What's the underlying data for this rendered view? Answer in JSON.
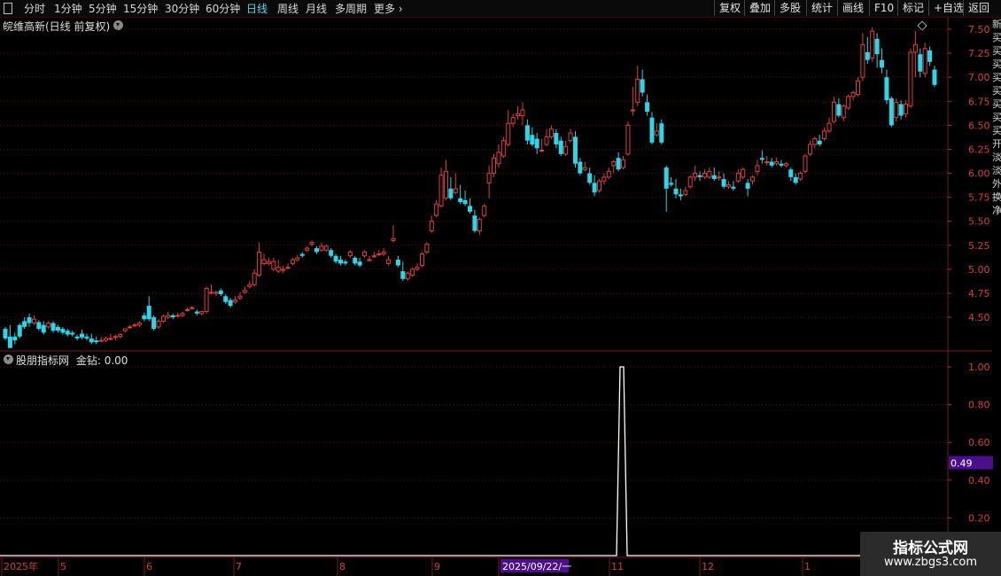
{
  "toolbar": {
    "periods": [
      "分时",
      "1分钟",
      "5分钟",
      "15分钟",
      "30分钟",
      "60分钟",
      "日线",
      "周线",
      "月线",
      "多周期",
      "更多"
    ],
    "active": "日线",
    "right_buttons": [
      "复权",
      "叠加",
      "多股",
      "统计",
      "画线",
      "F10",
      "标记",
      "+自选",
      "返回"
    ]
  },
  "main": {
    "title": "皖维高新(日线 前复权)"
  },
  "indicator": {
    "title": "股朋指标网",
    "value_label": "金钻: 0.00",
    "current_value_box": "0.49"
  },
  "watermark": {
    "line1": "指标公式网",
    "line2": "www.zbgs3.com"
  },
  "right_strip": [
    "新",
    "买",
    "买",
    "买",
    "买",
    "买",
    "买",
    "买",
    "买",
    "开",
    "淡",
    "淡",
    "外",
    "换",
    "净"
  ],
  "colors": {
    "up": "#e0403c",
    "down": "#2ed5e6",
    "grid": "#5a1212",
    "axis_text": "#d04040",
    "bg": "#000000",
    "highlight": "#4b0f8a"
  },
  "chart_data": [
    {
      "type": "candlestick",
      "ylim": [
        4.15,
        7.62
      ],
      "y_ticks": [
        "7.50",
        "7.25",
        "7.00",
        "6.75",
        "6.50",
        "6.25",
        "6.00",
        "5.75",
        "5.50",
        "5.25",
        "5.00",
        "4.75",
        "4.50"
      ],
      "x_ticks": [
        "2025年",
        "5",
        "6",
        "7",
        "8",
        "9",
        "2025/09/22/一",
        "11",
        "12",
        "1"
      ],
      "candles": [
        [
          4.38,
          4.4,
          4.28,
          4.26
        ],
        [
          4.3,
          4.42,
          4.18,
          4.2
        ],
        [
          4.3,
          4.34,
          4.26,
          4.22
        ],
        [
          4.42,
          4.44,
          4.3,
          4.28
        ],
        [
          4.46,
          4.5,
          4.4,
          4.38
        ],
        [
          4.5,
          4.54,
          4.44,
          4.4
        ],
        [
          4.44,
          4.52,
          4.48,
          4.42
        ],
        [
          4.45,
          4.47,
          4.38,
          4.36
        ],
        [
          4.42,
          4.46,
          4.34,
          4.32
        ],
        [
          4.4,
          4.46,
          4.44,
          4.38
        ],
        [
          4.44,
          4.46,
          4.36,
          4.34
        ],
        [
          4.4,
          4.42,
          4.36,
          4.34
        ],
        [
          4.38,
          4.4,
          4.34,
          4.32
        ],
        [
          4.36,
          4.38,
          4.32,
          4.3
        ],
        [
          4.34,
          4.36,
          4.32,
          4.3
        ],
        [
          4.3,
          4.32,
          4.28,
          4.26
        ],
        [
          4.33,
          4.37,
          4.29,
          4.27
        ],
        [
          4.3,
          4.33,
          4.28,
          4.26
        ],
        [
          4.28,
          4.33,
          4.24,
          4.22
        ],
        [
          4.26,
          4.3,
          4.24,
          4.22
        ],
        [
          4.26,
          4.3,
          4.26,
          4.24
        ],
        [
          4.26,
          4.3,
          4.28,
          4.24
        ],
        [
          4.28,
          4.33,
          4.28,
          4.26
        ],
        [
          4.29,
          4.32,
          4.3,
          4.26
        ],
        [
          4.3,
          4.34,
          4.32,
          4.28
        ],
        [
          4.36,
          4.38,
          4.38,
          4.34
        ],
        [
          4.4,
          4.42,
          4.4,
          4.38
        ],
        [
          4.42,
          4.44,
          4.42,
          4.4
        ],
        [
          4.42,
          4.46,
          4.44,
          4.4
        ],
        [
          4.52,
          4.55,
          4.48,
          4.46
        ],
        [
          4.62,
          4.72,
          4.48,
          4.46
        ],
        [
          4.5,
          4.52,
          4.38,
          4.36
        ],
        [
          4.4,
          4.48,
          4.46,
          4.38
        ],
        [
          4.46,
          4.53,
          4.51,
          4.44
        ],
        [
          4.5,
          4.56,
          4.52,
          4.48
        ],
        [
          4.52,
          4.54,
          4.5,
          4.48
        ],
        [
          4.52,
          4.55,
          4.52,
          4.5
        ],
        [
          4.52,
          4.56,
          4.54,
          4.5
        ],
        [
          4.58,
          4.6,
          4.58,
          4.56
        ],
        [
          4.6,
          4.62,
          4.6,
          4.58
        ],
        [
          4.56,
          4.58,
          4.54,
          4.52
        ],
        [
          4.54,
          4.56,
          4.56,
          4.52
        ],
        [
          4.56,
          4.82,
          4.8,
          4.54
        ],
        [
          4.76,
          4.84,
          4.76,
          4.74
        ],
        [
          4.75,
          4.78,
          4.76,
          4.72
        ],
        [
          4.78,
          4.8,
          4.74,
          4.72
        ],
        [
          4.72,
          4.74,
          4.66,
          4.64
        ],
        [
          4.68,
          4.7,
          4.62,
          4.6
        ],
        [
          4.66,
          4.72,
          4.68,
          4.64
        ],
        [
          4.7,
          4.76,
          4.72,
          4.68
        ],
        [
          4.76,
          4.82,
          4.78,
          4.74
        ],
        [
          4.82,
          4.88,
          4.84,
          4.8
        ],
        [
          4.84,
          5.0,
          4.96,
          4.82
        ],
        [
          4.94,
          5.28,
          5.18,
          4.92
        ],
        [
          5.06,
          5.16,
          5.1,
          5.04
        ],
        [
          5.06,
          5.12,
          5.08,
          5.04
        ],
        [
          5.0,
          5.12,
          5.08,
          4.98
        ],
        [
          4.98,
          5.1,
          5.02,
          4.96
        ],
        [
          4.99,
          5.04,
          5.0,
          4.96
        ],
        [
          5.02,
          5.06,
          5.02,
          5.0
        ],
        [
          5.06,
          5.12,
          5.1,
          5.04
        ],
        [
          5.1,
          5.15,
          5.12,
          5.08
        ],
        [
          5.16,
          5.18,
          5.14,
          5.12
        ],
        [
          5.2,
          5.24,
          5.22,
          5.18
        ],
        [
          5.26,
          5.3,
          5.28,
          5.24
        ],
        [
          5.22,
          5.24,
          5.18,
          5.16
        ],
        [
          5.2,
          5.28,
          5.24,
          5.18
        ],
        [
          5.2,
          5.26,
          5.24,
          5.18
        ],
        [
          5.2,
          5.22,
          5.14,
          5.12
        ],
        [
          5.14,
          5.16,
          5.08,
          5.06
        ],
        [
          5.1,
          5.14,
          5.06,
          5.04
        ],
        [
          5.08,
          5.1,
          5.06,
          5.04
        ],
        [
          5.14,
          5.2,
          5.18,
          5.12
        ],
        [
          5.12,
          5.14,
          5.06,
          5.04
        ],
        [
          5.08,
          5.12,
          5.04,
          5.02
        ],
        [
          5.14,
          5.2,
          5.18,
          5.12
        ],
        [
          5.1,
          5.14,
          5.1,
          5.08
        ],
        [
          5.14,
          5.18,
          5.14,
          5.12
        ],
        [
          5.16,
          5.2,
          5.16,
          5.14
        ],
        [
          5.16,
          5.22,
          5.18,
          5.14
        ],
        [
          5.06,
          5.14,
          5.1,
          5.04
        ],
        [
          5.3,
          5.46,
          5.32,
          5.28
        ],
        [
          5.1,
          5.14,
          5.04,
          5.02
        ],
        [
          4.98,
          5.08,
          4.9,
          4.88
        ],
        [
          4.9,
          4.98,
          4.96,
          4.88
        ],
        [
          4.94,
          5.02,
          5.0,
          4.92
        ],
        [
          5.0,
          5.06,
          5.02,
          4.98
        ],
        [
          5.04,
          5.18,
          5.16,
          5.02
        ],
        [
          5.18,
          5.28,
          5.26,
          5.16
        ],
        [
          5.4,
          5.56,
          5.5,
          5.38
        ],
        [
          5.56,
          5.72,
          5.68,
          5.54
        ],
        [
          5.66,
          6.06,
          5.98,
          5.64
        ],
        [
          5.74,
          6.14,
          6.02,
          5.72
        ],
        [
          5.84,
          5.96,
          5.74,
          5.72
        ],
        [
          5.8,
          6.0,
          5.84,
          5.78
        ],
        [
          5.74,
          5.88,
          5.7,
          5.68
        ],
        [
          5.72,
          5.82,
          5.68,
          5.66
        ],
        [
          5.66,
          5.74,
          5.6,
          5.58
        ],
        [
          5.56,
          5.62,
          5.4,
          5.38
        ],
        [
          5.4,
          5.54,
          5.52,
          5.36
        ],
        [
          5.56,
          5.68,
          5.66,
          5.54
        ],
        [
          5.9,
          6.08,
          6.0,
          5.74
        ],
        [
          6.0,
          6.2,
          6.16,
          5.96
        ],
        [
          6.1,
          6.3,
          6.22,
          6.06
        ],
        [
          6.18,
          6.38,
          6.34,
          6.16
        ],
        [
          6.3,
          6.66,
          6.52,
          6.28
        ],
        [
          6.52,
          6.62,
          6.58,
          6.48
        ],
        [
          6.6,
          6.7,
          6.62,
          6.56
        ],
        [
          6.6,
          6.74,
          6.66,
          6.5
        ],
        [
          6.5,
          6.56,
          6.34,
          6.3
        ],
        [
          6.4,
          6.48,
          6.3,
          6.28
        ],
        [
          6.36,
          6.42,
          6.26,
          6.2
        ],
        [
          6.24,
          6.36,
          6.24,
          6.22
        ],
        [
          6.3,
          6.46,
          6.38,
          6.28
        ],
        [
          6.38,
          6.5,
          6.46,
          6.36
        ],
        [
          6.42,
          6.46,
          6.3,
          6.26
        ],
        [
          6.34,
          6.38,
          6.2,
          6.18
        ],
        [
          6.2,
          6.34,
          6.28,
          6.18
        ],
        [
          6.34,
          6.46,
          6.42,
          6.32
        ],
        [
          6.38,
          6.44,
          6.1,
          6.06
        ],
        [
          6.12,
          6.16,
          6.0,
          5.98
        ],
        [
          6.04,
          6.12,
          6.06,
          6.02
        ],
        [
          6.0,
          6.06,
          5.9,
          5.88
        ],
        [
          5.9,
          5.98,
          5.8,
          5.76
        ],
        [
          5.82,
          5.94,
          5.92,
          5.8
        ],
        [
          5.92,
          6.0,
          5.96,
          5.88
        ],
        [
          5.96,
          6.06,
          6.02,
          5.94
        ],
        [
          6.08,
          6.14,
          6.12,
          6.0
        ],
        [
          6.16,
          6.22,
          6.04,
          6.02
        ],
        [
          6.06,
          6.18,
          6.14,
          6.04
        ],
        [
          6.2,
          6.54,
          6.5,
          6.18
        ],
        [
          6.66,
          6.9,
          6.66,
          6.6
        ],
        [
          6.74,
          7.12,
          6.98,
          6.7
        ],
        [
          6.98,
          7.08,
          6.84,
          6.8
        ],
        [
          6.74,
          6.82,
          6.64,
          6.6
        ],
        [
          6.58,
          6.64,
          6.32,
          6.3
        ],
        [
          6.4,
          6.52,
          6.44,
          6.38
        ],
        [
          6.52,
          6.56,
          6.32,
          6.3
        ],
        [
          6.06,
          6.08,
          5.84,
          5.6
        ],
        [
          5.9,
          5.96,
          5.88,
          5.86
        ],
        [
          5.84,
          5.94,
          5.78,
          5.74
        ],
        [
          5.78,
          5.84,
          5.76,
          5.72
        ],
        [
          5.78,
          5.86,
          5.82,
          5.76
        ],
        [
          5.86,
          5.98,
          5.96,
          5.84
        ],
        [
          5.96,
          6.08,
          6.0,
          5.92
        ],
        [
          5.98,
          6.02,
          5.96,
          5.92
        ],
        [
          5.96,
          6.04,
          6.0,
          5.94
        ],
        [
          5.96,
          6.06,
          6.02,
          5.94
        ],
        [
          5.98,
          6.06,
          5.94,
          5.92
        ],
        [
          5.96,
          6.02,
          5.96,
          5.92
        ],
        [
          5.94,
          6.0,
          5.86,
          5.84
        ],
        [
          5.86,
          5.92,
          5.88,
          5.84
        ],
        [
          5.86,
          5.92,
          5.84,
          5.82
        ],
        [
          5.92,
          6.04,
          6.0,
          5.9
        ],
        [
          5.96,
          6.06,
          6.04,
          5.94
        ],
        [
          5.9,
          5.94,
          5.84,
          5.76
        ],
        [
          5.92,
          5.98,
          5.96,
          5.88
        ],
        [
          6.02,
          6.14,
          6.08,
          5.98
        ],
        [
          6.16,
          6.24,
          6.14,
          6.1
        ],
        [
          6.12,
          6.18,
          6.12,
          6.08
        ],
        [
          6.12,
          6.16,
          6.08,
          6.06
        ],
        [
          6.1,
          6.16,
          6.12,
          6.08
        ],
        [
          6.1,
          6.14,
          6.08,
          6.06
        ],
        [
          6.08,
          6.12,
          6.1,
          6.06
        ],
        [
          6.04,
          6.06,
          5.96,
          5.92
        ],
        [
          5.96,
          6.0,
          5.9,
          5.88
        ],
        [
          5.94,
          6.02,
          6.0,
          5.92
        ],
        [
          6.02,
          6.2,
          6.18,
          6.0
        ],
        [
          6.2,
          6.34,
          6.3,
          6.18
        ],
        [
          6.3,
          6.38,
          6.36,
          6.26
        ],
        [
          6.34,
          6.4,
          6.3,
          6.28
        ],
        [
          6.36,
          6.48,
          6.44,
          6.34
        ],
        [
          6.44,
          6.58,
          6.52,
          6.42
        ],
        [
          6.54,
          6.8,
          6.74,
          6.52
        ],
        [
          6.72,
          6.78,
          6.6,
          6.58
        ],
        [
          6.58,
          6.72,
          6.7,
          6.54
        ],
        [
          6.68,
          6.82,
          6.8,
          6.66
        ],
        [
          6.8,
          6.86,
          6.84,
          6.76
        ],
        [
          6.82,
          7.0,
          6.96,
          6.8
        ],
        [
          7.0,
          7.46,
          7.34,
          6.96
        ],
        [
          7.26,
          7.42,
          7.18,
          7.14
        ],
        [
          7.2,
          7.52,
          7.48,
          7.16
        ],
        [
          7.4,
          7.46,
          7.24,
          7.1
        ],
        [
          7.18,
          7.3,
          7.1,
          7.04
        ],
        [
          7.0,
          7.08,
          6.76,
          6.72
        ],
        [
          6.78,
          6.8,
          6.5,
          6.48
        ],
        [
          6.58,
          6.78,
          6.74,
          6.54
        ],
        [
          6.72,
          6.76,
          6.6,
          6.56
        ],
        [
          6.62,
          6.76,
          6.72,
          6.58
        ],
        [
          6.7,
          7.3,
          7.26,
          6.68
        ],
        [
          7.26,
          7.48,
          7.34,
          7.0
        ],
        [
          7.24,
          7.3,
          7.06,
          7.0
        ],
        [
          7.04,
          7.36,
          7.3,
          7.0
        ],
        [
          7.28,
          7.32,
          7.16,
          7.12
        ],
        [
          7.08,
          7.12,
          6.92,
          6.9
        ]
      ],
      "signal_value": 1.0,
      "signal_ylim": [
        0.0,
        1.08
      ],
      "signal_y_ticks": [
        "1.00",
        "0.80",
        "0.60",
        "0.40",
        "0.20"
      ]
    }
  ]
}
